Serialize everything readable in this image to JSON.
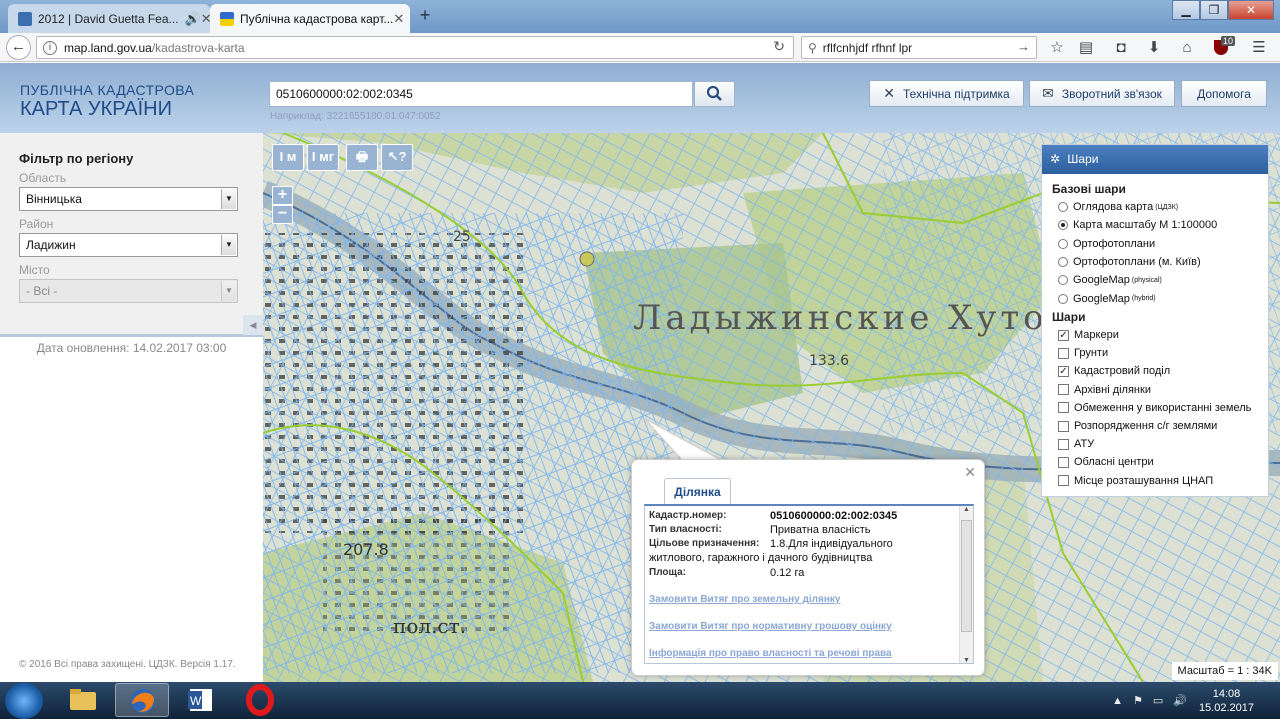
{
  "browser": {
    "tabs": [
      {
        "title": "2012 | David Guetta Fea...",
        "icon": "youtube-icon"
      },
      {
        "title": "Публічна кадастрова карт...",
        "icon": "ukraine-flag-icon"
      }
    ],
    "url_host": "map.land.gov.ua",
    "url_path": "/kadastrova-karta",
    "search_value": "rflfcnhjdf rfhnf lpr",
    "ublock_count": "10"
  },
  "header": {
    "logo_line1": "ПУБЛІЧНА КАДАСТРОВА",
    "logo_line2": "КАРТА УКРАЇНИ",
    "search_value": "0510600000:02:002:0345",
    "search_hint": "Наприклад: 3221655100:01:047:0052",
    "tech_support": "Технічна підтримка",
    "feedback": "Зворотний зв'язок",
    "help": "Допомога"
  },
  "filter": {
    "title": "Фільтр по регіону",
    "oblast_label": "Область",
    "oblast_value": "Вінницька",
    "raion_label": "Район",
    "raion_value": "Ладижин",
    "city_label": "Місто",
    "city_value": "- Всі -",
    "update_date": "Дата оновлення: 14.02.2017 03:00",
    "copyright": "© 2016 Всі права захищені. ЦДЗК. Версія 1.17."
  },
  "map_tools": [
    "I м",
    "I мг",
    "🖶",
    "↖?"
  ],
  "layers": {
    "title": "Шари",
    "base_title": "Базові шари",
    "base": [
      {
        "label": "Оглядова карта",
        "sup": "(ЦДЗК)",
        "selected": false
      },
      {
        "label": "Карта масштабу М 1:100000",
        "sup": "",
        "selected": true
      },
      {
        "label": "Ортофотоплани",
        "sup": "",
        "selected": false
      },
      {
        "label": "Ортофотоплани (м. Київ)",
        "sup": "",
        "selected": false
      },
      {
        "label": "GoogleMap",
        "sup": "(physical)",
        "selected": false
      },
      {
        "label": "GoogleMap",
        "sup": "(hybrid)",
        "selected": false
      }
    ],
    "overlay_title": "Шари",
    "overlays": [
      {
        "label": "Маркери",
        "checked": true
      },
      {
        "label": "Грунти",
        "checked": false
      },
      {
        "label": "Кадастровий поділ",
        "checked": true
      },
      {
        "label": "Архівні ділянки",
        "checked": false
      },
      {
        "label": "Обмеження у використанні земель",
        "checked": false
      },
      {
        "label": "Розпорядження с/г землями",
        "checked": false
      },
      {
        "label": "АТУ",
        "checked": false
      },
      {
        "label": "Обласні центри",
        "checked": false
      },
      {
        "label": "Місце розташування ЦНАП",
        "checked": false
      }
    ]
  },
  "popup": {
    "tab": "Ділянка",
    "rows": [
      {
        "key": "Кадастр.номер:",
        "value": "0510600000:02:002:0345"
      },
      {
        "key": "Тип власності:",
        "value": "Приватна власність"
      },
      {
        "key": "Цільове призначення:",
        "value": "1.8.Для індивідуального"
      },
      {
        "key": "",
        "value": "житлового, гаражного і дачного будівництва"
      },
      {
        "key": "Площа:",
        "value": "0.12 га"
      }
    ],
    "links": [
      "Замовити Витяг про земельну ділянку",
      "Замовити Витяг про нормативну грошову оцінку",
      "Інформація про право власності та речові права"
    ]
  },
  "map_labels": [
    "Ладыжинские Хутор",
    "пол.ст.",
    "207.8",
    "133.6",
    "25"
  ],
  "scale": "Масштаб = 1 : 34K",
  "taskbar": {
    "time": "14:08",
    "date": "15.02.2017"
  },
  "colors": {
    "cadastre_line": "#7fb6f0",
    "boundary_line": "#9acd32",
    "header_blue": "#1f4c88"
  }
}
